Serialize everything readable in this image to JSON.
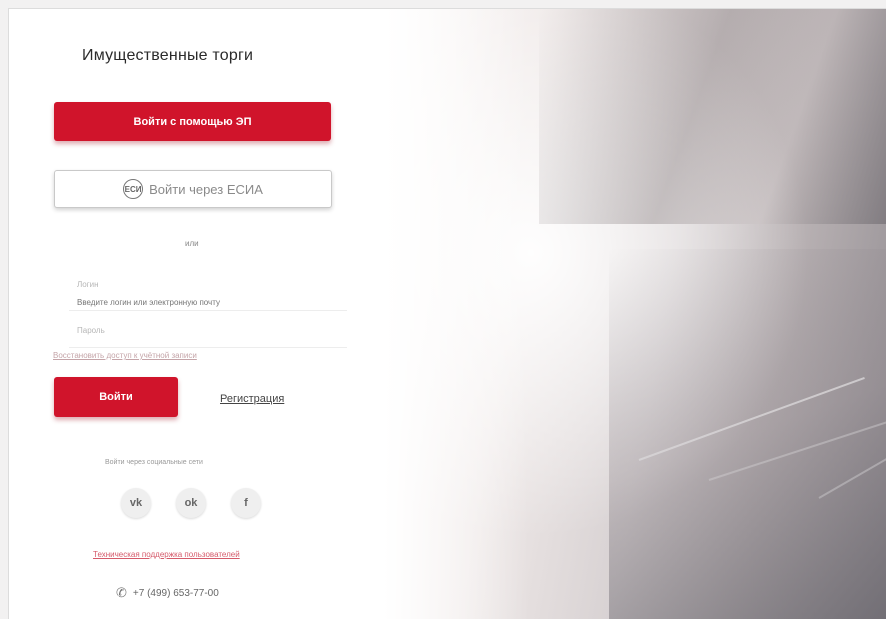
{
  "title": "Имущественные торги",
  "buttons": {
    "login_ep": "Войти с помощью ЭП",
    "login_esia": "Войти через ЕСИА",
    "login": "Войти",
    "register": "Регистрация"
  },
  "esia_icon": {
    "name": "esia-icon",
    "glyph": "ЕСИ"
  },
  "divider_text": "или",
  "form": {
    "login_label": "Логин",
    "login_placeholder": "Введите логин или электронную почту",
    "password_label": "Пароль",
    "forgot_link": "Восстановить доступ к учётной записи"
  },
  "social": {
    "caption": "Войти через социальные сети",
    "items": [
      {
        "name": "vk-icon",
        "glyph": "vk"
      },
      {
        "name": "odnoklassniki-icon",
        "glyph": "ok"
      },
      {
        "name": "facebook-icon",
        "glyph": "f"
      }
    ]
  },
  "help_link": "Техническая поддержка пользователей",
  "phone": {
    "icon": "phone-icon",
    "number": "+7 (499) 653-77-00"
  },
  "colors": {
    "accent": "#d0142b",
    "link": "#d55a6a"
  }
}
